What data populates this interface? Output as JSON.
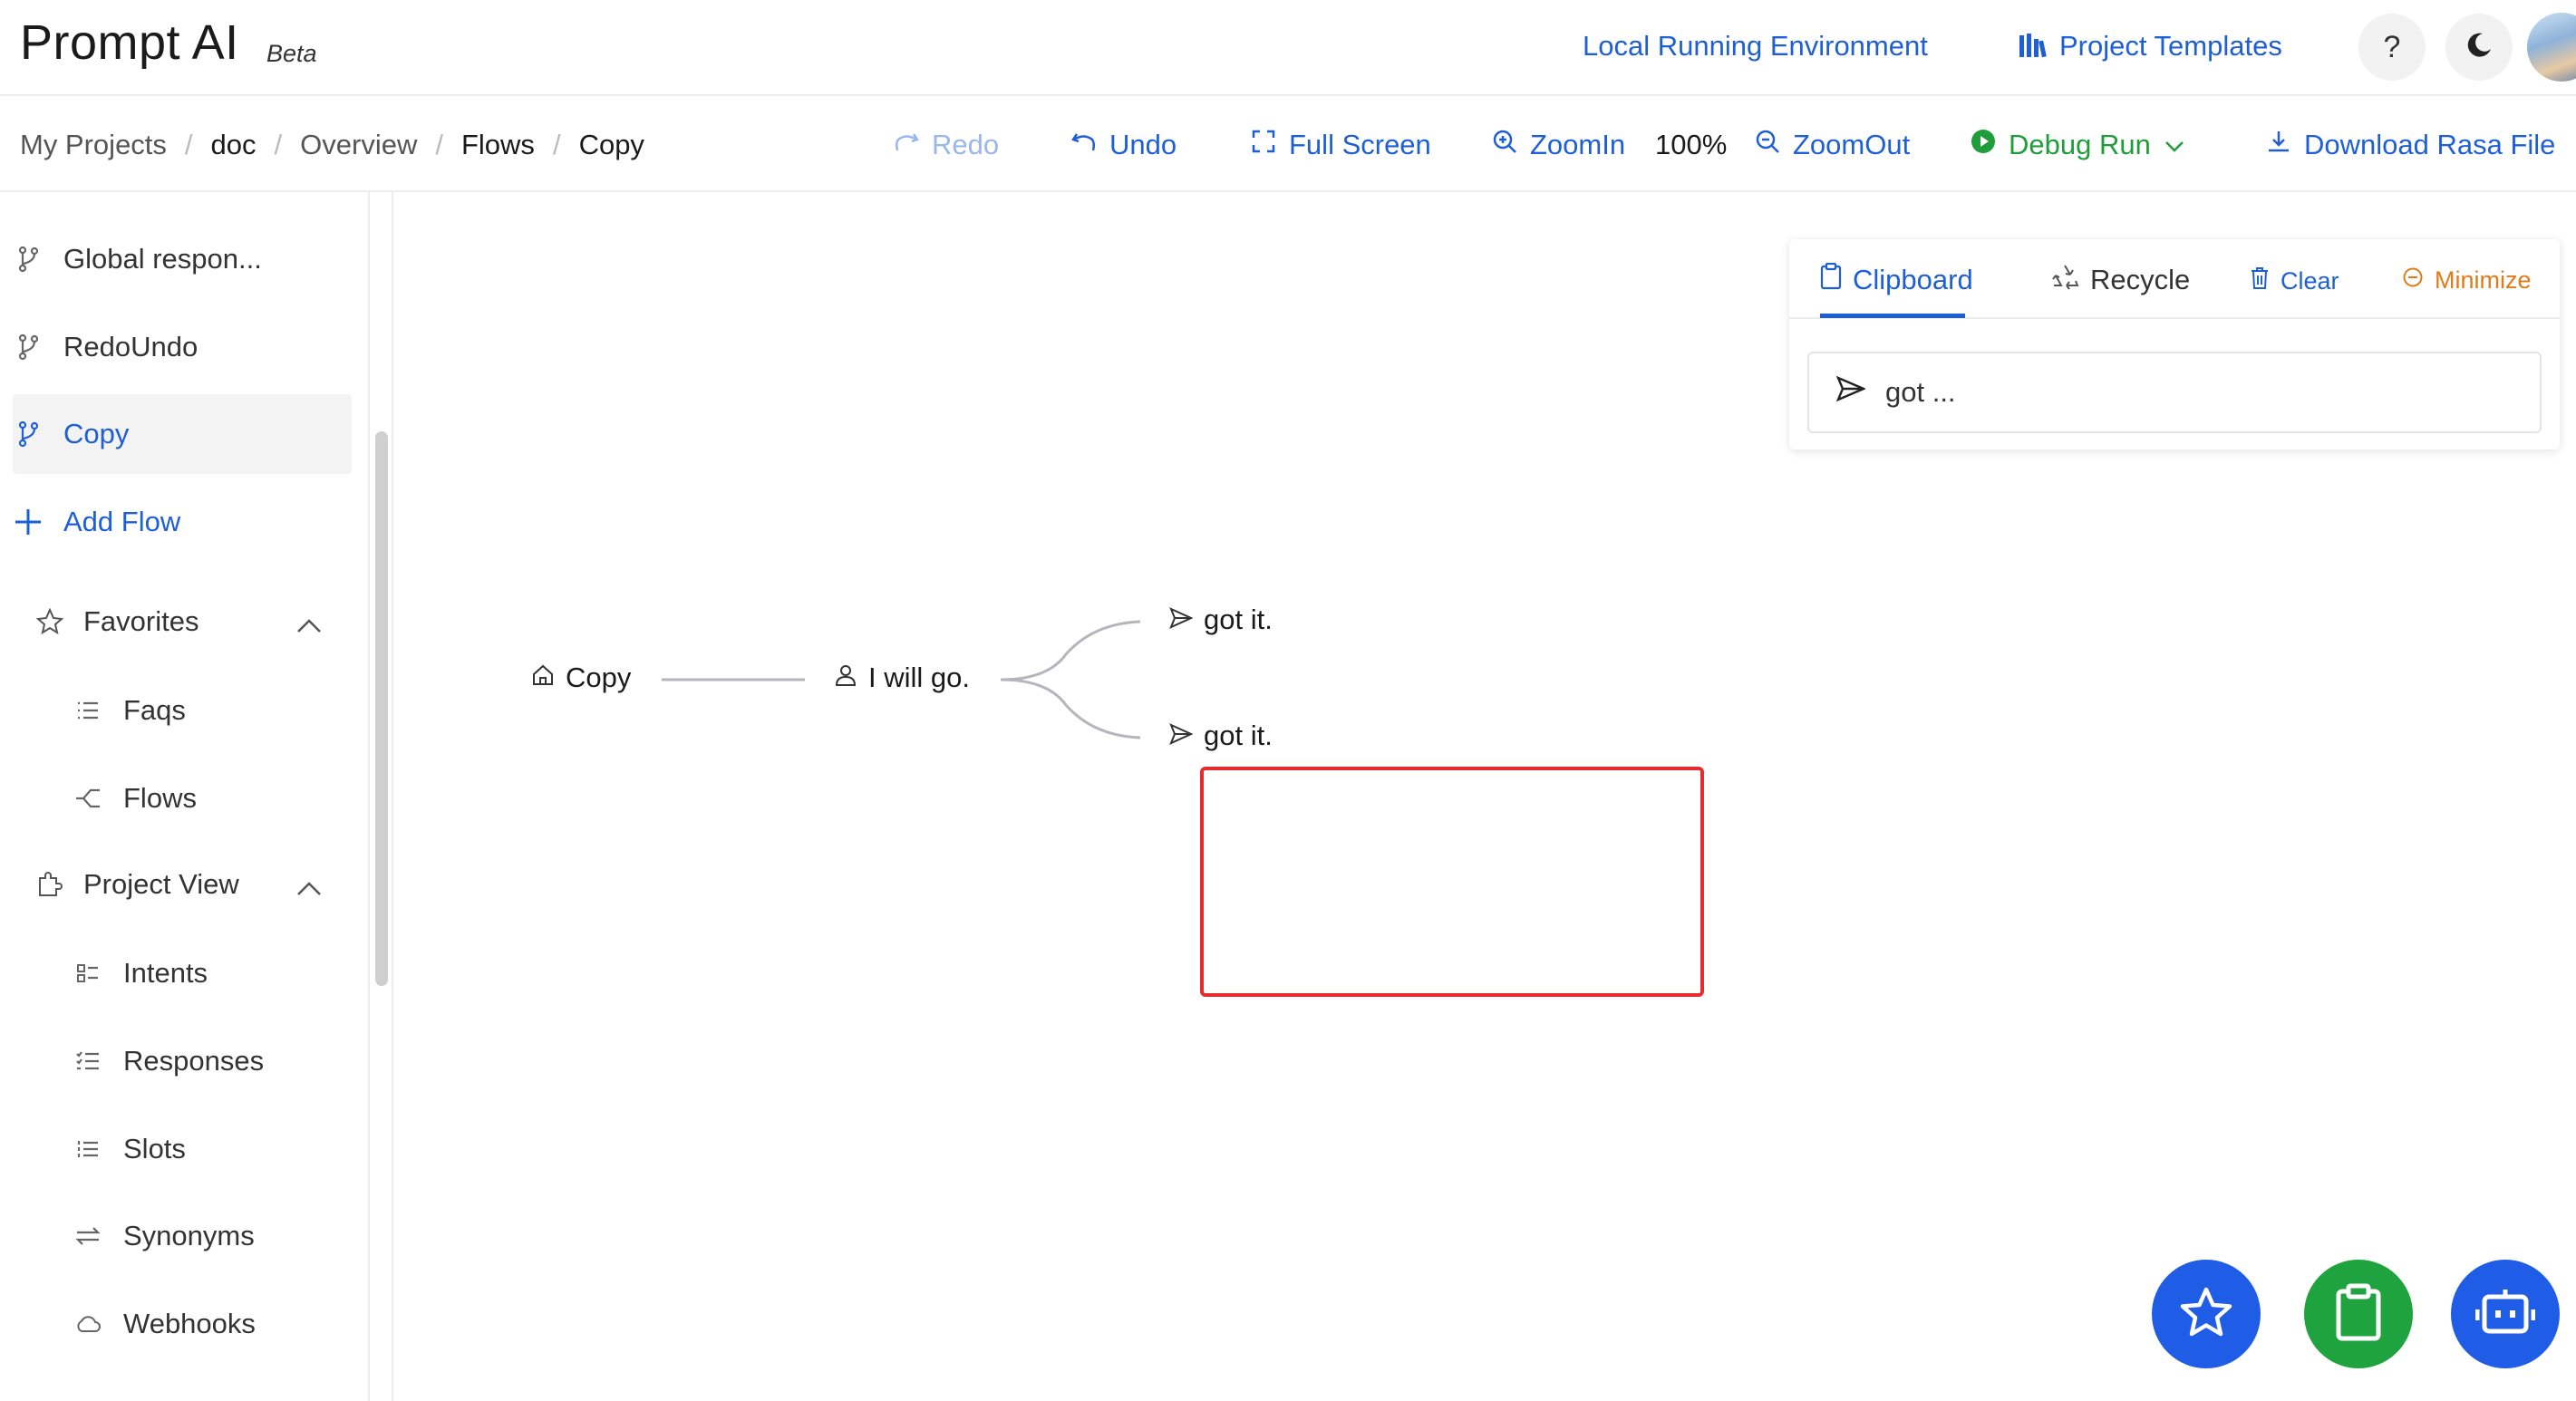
{
  "header": {
    "logo": "Prompt AI",
    "beta": "Beta",
    "local_env": "Local Running Environment",
    "templates": "Project Templates",
    "help": "?"
  },
  "breadcrumb": [
    "My Projects",
    "doc",
    "Overview",
    "Flows",
    "Copy"
  ],
  "toolbar": {
    "redo": "Redo",
    "undo": "Undo",
    "fullscreen": "Full Screen",
    "zoomin": "ZoomIn",
    "zoom_level": "100%",
    "zoomout": "ZoomOut",
    "debug": "Debug Run",
    "download": "Download Rasa File"
  },
  "sidebar": {
    "flows": [
      {
        "label": "Global respon...",
        "icon": "branch-icon"
      },
      {
        "label": "RedoUndo",
        "icon": "branch-icon"
      },
      {
        "label": "Copy",
        "icon": "branch-icon",
        "active": true
      }
    ],
    "add_flow": "Add Flow",
    "favorites": {
      "label": "Favorites",
      "items": [
        {
          "label": "Faqs",
          "icon": "list-icon"
        },
        {
          "label": "Flows",
          "icon": "flow-icon"
        }
      ]
    },
    "project_view": {
      "label": "Project View",
      "items": [
        {
          "label": "Intents",
          "icon": "intent-icon"
        },
        {
          "label": "Responses",
          "icon": "responses-icon"
        },
        {
          "label": "Slots",
          "icon": "slots-icon"
        },
        {
          "label": "Synonyms",
          "icon": "swap-icon"
        },
        {
          "label": "Webhooks",
          "icon": "cloud-icon"
        }
      ]
    }
  },
  "canvas": {
    "root": "Copy",
    "user_node": "I will go.",
    "bot_nodes": [
      "got it.",
      "got it."
    ]
  },
  "clipboard_panel": {
    "tabs": {
      "clipboard": "Clipboard",
      "recycle": "Recycle",
      "clear": "Clear",
      "minimize": "Minimize"
    },
    "items": [
      "got ..."
    ]
  },
  "colors": {
    "primary": "#1e5fd6",
    "green": "#1f9d3a",
    "orange": "#e07b1a",
    "selection": "#e52b2b",
    "fab_blue": "#1f5de6",
    "fab_green": "#1fa33f"
  }
}
